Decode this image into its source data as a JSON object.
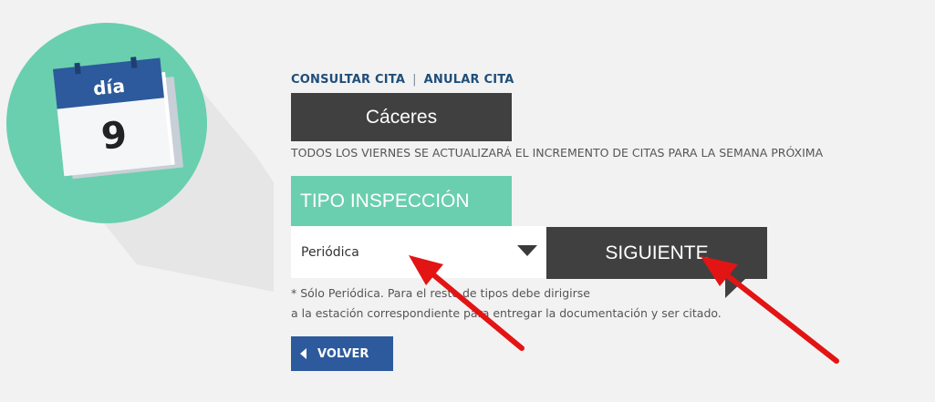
{
  "logo": {
    "calendar_label": "día",
    "calendar_day": "9",
    "icon": "calendar-icon"
  },
  "links": {
    "consult": "CONSULTAR CITA",
    "separator": "|",
    "cancel": "ANULAR CITA"
  },
  "city": {
    "label": "Cáceres"
  },
  "notice": "TODOS LOS VIERNES SE ACTUALIZARÁ EL INCREMENTO DE CITAS PARA LA SEMANA PRÓXIMA",
  "tipo": {
    "label": "TIPO INSPECCIÓN"
  },
  "select": {
    "value": "Periódica",
    "icon": "caret-down-icon"
  },
  "next_button": {
    "label": "SIGUIENTE"
  },
  "note": {
    "line1": "* Sólo Periódica. Para el resto de tipos debe dirigirse",
    "line2": "a la estación correspondiente para entregar la documentación y ser citado."
  },
  "back_button": {
    "label": "VOLVER",
    "icon": "caret-left-icon"
  },
  "colors": {
    "teal": "#6acfae",
    "dark_button": "#404040",
    "blue": "#2c5a9c",
    "link": "#1f4e79",
    "annotation_red": "#e31414"
  }
}
